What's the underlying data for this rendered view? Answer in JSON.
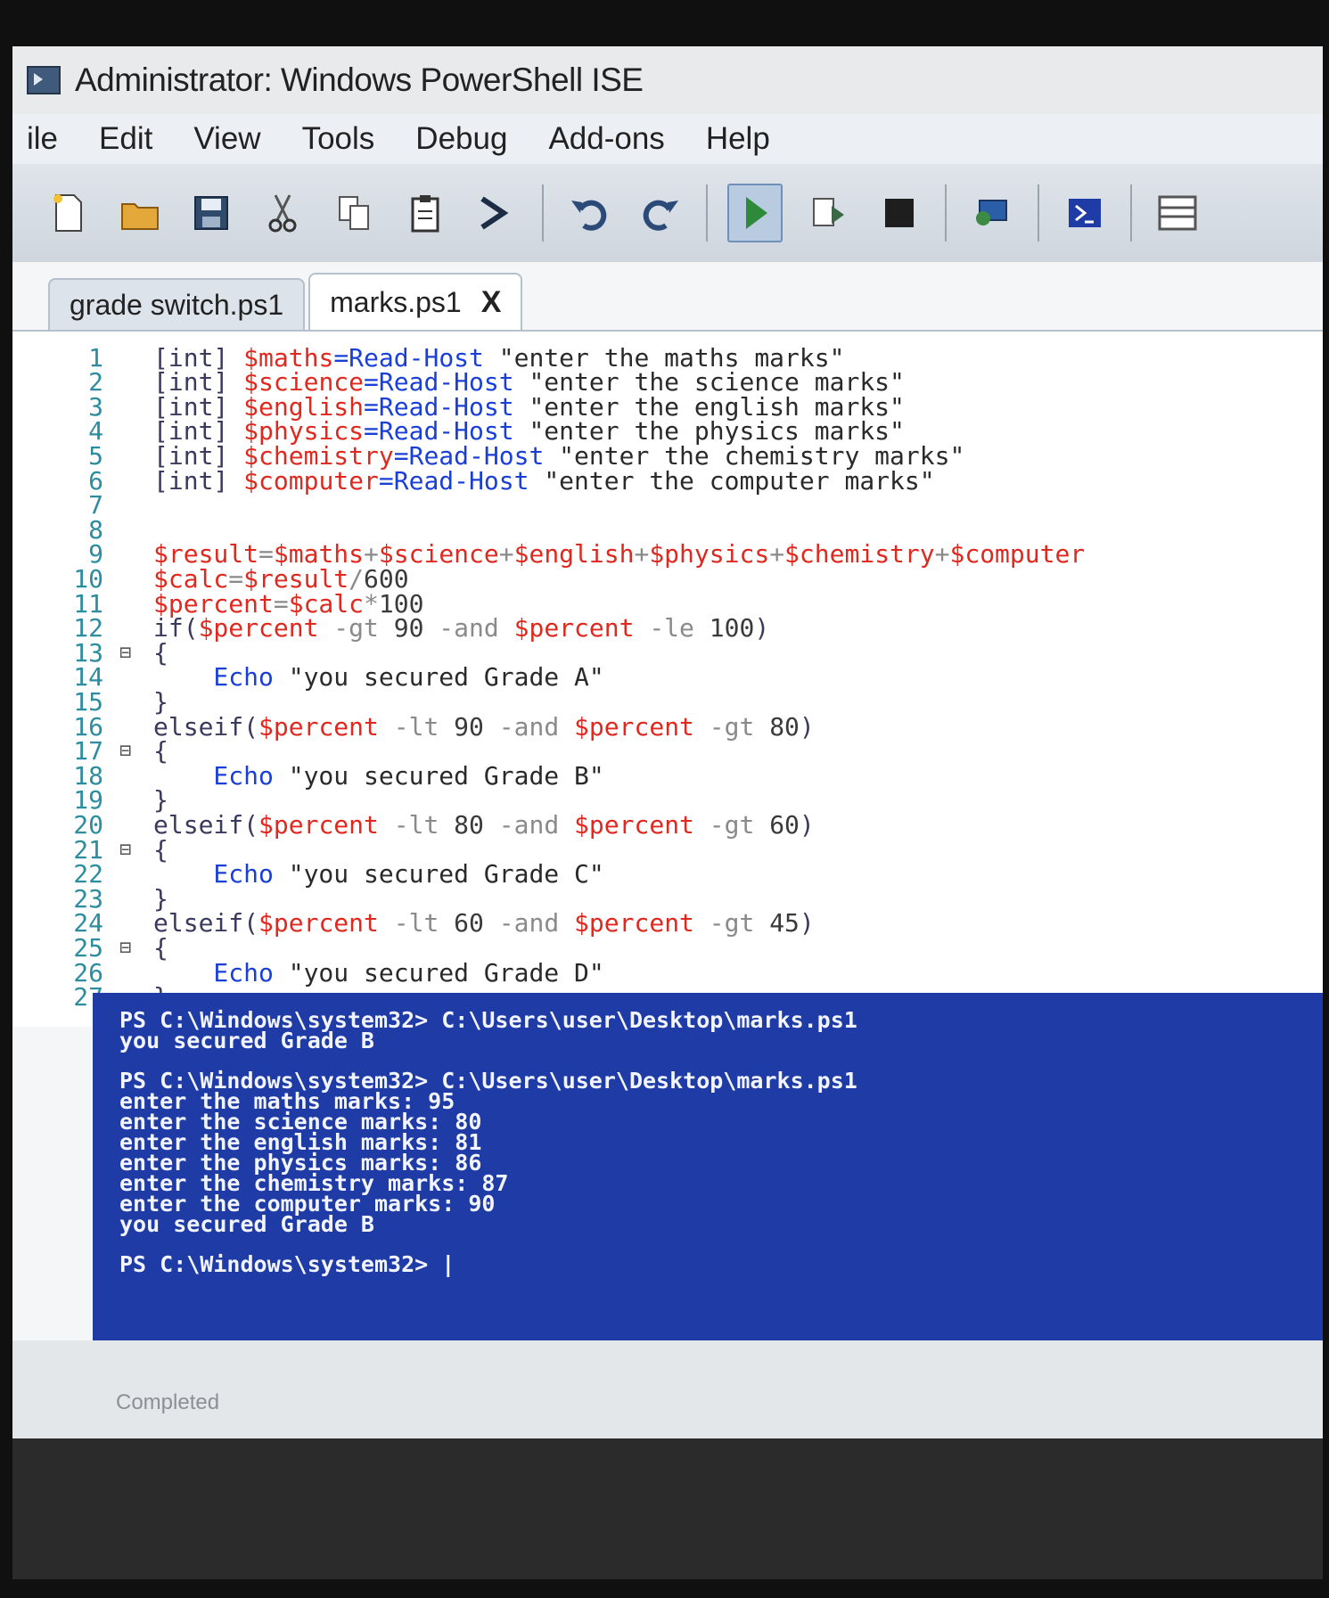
{
  "window": {
    "title": "Administrator: Windows PowerShell ISE"
  },
  "menu": [
    "ile",
    "Edit",
    "View",
    "Tools",
    "Debug",
    "Add-ons",
    "Help"
  ],
  "toolbar": {
    "icons": [
      "new-file-icon",
      "open-folder-icon",
      "save-icon",
      "cut-icon",
      "copy-icon",
      "paste-icon",
      "powershell-prompt-icon",
      "undo-icon",
      "redo-icon",
      "run-script-icon",
      "run-selection-icon",
      "stop-icon",
      "remote-powershell-icon",
      "powershell-console-icon",
      "layout-icon"
    ]
  },
  "tabs": [
    {
      "label": "grade switch.ps1",
      "active": false
    },
    {
      "label": "marks.ps1",
      "active": true,
      "close": "X"
    }
  ],
  "editor": {
    "lines": [
      {
        "n": "1",
        "fold": "",
        "tokens": [
          [
            "type",
            "[int] "
          ],
          [
            "var",
            "$maths"
          ],
          [
            "cmd",
            "=Read-Host "
          ],
          [
            "str",
            "\"enter the maths marks\""
          ]
        ]
      },
      {
        "n": "2",
        "fold": "",
        "tokens": [
          [
            "type",
            "[int] "
          ],
          [
            "var",
            "$science"
          ],
          [
            "cmd",
            "=Read-Host "
          ],
          [
            "str",
            "\"enter the science marks\""
          ]
        ]
      },
      {
        "n": "3",
        "fold": "",
        "tokens": [
          [
            "type",
            "[int] "
          ],
          [
            "var",
            "$english"
          ],
          [
            "cmd",
            "=Read-Host "
          ],
          [
            "str",
            "\"enter the english marks\""
          ]
        ]
      },
      {
        "n": "4",
        "fold": "",
        "tokens": [
          [
            "type",
            "[int] "
          ],
          [
            "var",
            "$physics"
          ],
          [
            "cmd",
            "=Read-Host "
          ],
          [
            "str",
            "\"enter the physics marks\""
          ]
        ]
      },
      {
        "n": "5",
        "fold": "",
        "tokens": [
          [
            "type",
            "[int] "
          ],
          [
            "var",
            "$chemistry"
          ],
          [
            "cmd",
            "=Read-Host "
          ],
          [
            "str",
            "\"enter the chemistry marks\""
          ]
        ]
      },
      {
        "n": "6",
        "fold": "",
        "tokens": [
          [
            "type",
            "[int] "
          ],
          [
            "var",
            "$computer"
          ],
          [
            "cmd",
            "=Read-Host "
          ],
          [
            "str",
            "\"enter the computer marks\""
          ]
        ]
      },
      {
        "n": "7",
        "fold": "",
        "tokens": []
      },
      {
        "n": "8",
        "fold": "",
        "tokens": []
      },
      {
        "n": "9",
        "fold": "",
        "tokens": [
          [
            "var",
            "$result"
          ],
          [
            "op",
            "="
          ],
          [
            "var",
            "$maths"
          ],
          [
            "op",
            "+"
          ],
          [
            "var",
            "$science"
          ],
          [
            "op",
            "+"
          ],
          [
            "var",
            "$english"
          ],
          [
            "op",
            "+"
          ],
          [
            "var",
            "$physics"
          ],
          [
            "op",
            "+"
          ],
          [
            "var",
            "$chemistry"
          ],
          [
            "op",
            "+"
          ],
          [
            "var",
            "$computer"
          ]
        ]
      },
      {
        "n": "10",
        "fold": "",
        "tokens": [
          [
            "var",
            "$calc"
          ],
          [
            "op",
            "="
          ],
          [
            "var",
            "$result"
          ],
          [
            "op",
            "/"
          ],
          [
            "num",
            "600"
          ]
        ]
      },
      {
        "n": "11",
        "fold": "",
        "tokens": [
          [
            "var",
            "$percent"
          ],
          [
            "op",
            "="
          ],
          [
            "var",
            "$calc"
          ],
          [
            "op",
            "*"
          ],
          [
            "num",
            "100"
          ]
        ]
      },
      {
        "n": "12",
        "fold": "",
        "tokens": [
          [
            "type",
            "if("
          ],
          [
            "var",
            "$percent"
          ],
          [
            "op",
            " -gt "
          ],
          [
            "num",
            "90"
          ],
          [
            "op",
            " -and "
          ],
          [
            "var",
            "$percent"
          ],
          [
            "op",
            " -le "
          ],
          [
            "num",
            "100"
          ],
          [
            "type",
            ")"
          ]
        ]
      },
      {
        "n": "13",
        "fold": "⊟",
        "tokens": [
          [
            "type",
            "{"
          ]
        ]
      },
      {
        "n": "14",
        "fold": "",
        "tokens": [
          [
            "cmd",
            "    Echo "
          ],
          [
            "str",
            "\"you secured Grade A\""
          ]
        ]
      },
      {
        "n": "15",
        "fold": "",
        "tokens": [
          [
            "type",
            "}"
          ]
        ]
      },
      {
        "n": "16",
        "fold": "",
        "tokens": [
          [
            "type",
            "elseif("
          ],
          [
            "var",
            "$percent"
          ],
          [
            "op",
            " -lt "
          ],
          [
            "num",
            "90"
          ],
          [
            "op",
            " -and "
          ],
          [
            "var",
            "$percent"
          ],
          [
            "op",
            " -gt "
          ],
          [
            "num",
            "80"
          ],
          [
            "type",
            ")"
          ]
        ]
      },
      {
        "n": "17",
        "fold": "⊟",
        "tokens": [
          [
            "type",
            "{"
          ]
        ]
      },
      {
        "n": "18",
        "fold": "",
        "tokens": [
          [
            "cmd",
            "    Echo "
          ],
          [
            "str",
            "\"you secured Grade B\""
          ]
        ]
      },
      {
        "n": "19",
        "fold": "",
        "tokens": [
          [
            "type",
            "}"
          ]
        ]
      },
      {
        "n": "20",
        "fold": "",
        "tokens": [
          [
            "type",
            "elseif("
          ],
          [
            "var",
            "$percent"
          ],
          [
            "op",
            " -lt "
          ],
          [
            "num",
            "80"
          ],
          [
            "op",
            " -and "
          ],
          [
            "var",
            "$percent"
          ],
          [
            "op",
            " -gt "
          ],
          [
            "num",
            "60"
          ],
          [
            "type",
            ")"
          ]
        ]
      },
      {
        "n": "21",
        "fold": "⊟",
        "tokens": [
          [
            "type",
            "{"
          ]
        ]
      },
      {
        "n": "22",
        "fold": "",
        "tokens": [
          [
            "cmd",
            "    Echo "
          ],
          [
            "str",
            "\"you secured Grade C\""
          ]
        ]
      },
      {
        "n": "23",
        "fold": "",
        "tokens": [
          [
            "type",
            "}"
          ]
        ]
      },
      {
        "n": "24",
        "fold": "",
        "tokens": [
          [
            "type",
            "elseif("
          ],
          [
            "var",
            "$percent"
          ],
          [
            "op",
            " -lt "
          ],
          [
            "num",
            "60"
          ],
          [
            "op",
            " -and "
          ],
          [
            "var",
            "$percent"
          ],
          [
            "op",
            " -gt "
          ],
          [
            "num",
            "45"
          ],
          [
            "type",
            ")"
          ]
        ]
      },
      {
        "n": "25",
        "fold": "⊟",
        "tokens": [
          [
            "type",
            "{"
          ]
        ]
      },
      {
        "n": "26",
        "fold": "",
        "tokens": [
          [
            "cmd",
            "    Echo "
          ],
          [
            "str",
            "\"you secured Grade D\""
          ]
        ]
      },
      {
        "n": "27",
        "fold": "",
        "tokens": [
          [
            "type",
            "}"
          ]
        ]
      }
    ]
  },
  "console": {
    "lines": [
      "PS C:\\Windows\\system32> C:\\Users\\user\\Desktop\\marks.ps1",
      "you secured Grade B",
      "",
      "PS C:\\Windows\\system32> C:\\Users\\user\\Desktop\\marks.ps1",
      "enter the maths marks: 95",
      "enter the science marks: 80",
      "enter the english marks: 81",
      "enter the physics marks: 86",
      "enter the chemistry marks: 87",
      "enter the computer marks: 90",
      "you secured Grade B",
      "",
      "PS C:\\Windows\\system32> |"
    ]
  },
  "status": {
    "text": "Completed"
  },
  "colors": {
    "console_bg": "#1f3ba6",
    "variable": "#e0281e",
    "command": "#1a3fd6"
  }
}
